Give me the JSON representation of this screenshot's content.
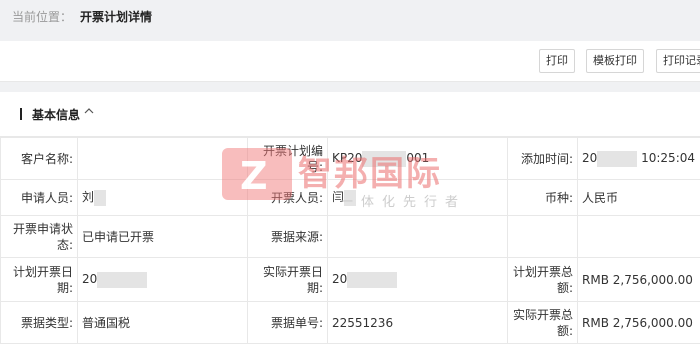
{
  "breadcrumb": {
    "label": "当前位置：",
    "current": "开票计划详情"
  },
  "toolbar": {
    "print": "打印",
    "template_print": "模板打印",
    "print_log": "打印记录"
  },
  "section": {
    "title": "基本信息"
  },
  "fields": {
    "customer_name": {
      "label": "客户名称:",
      "value": ""
    },
    "plan_no": {
      "label": "开票计划编号:",
      "value_prefix": "KP20",
      "value_suffix": "001"
    },
    "add_time": {
      "label": "添加时间:",
      "value_prefix": "20",
      "value_suffix": "10:25:04"
    },
    "applicant": {
      "label": "申请人员:",
      "value": "刘"
    },
    "issuer": {
      "label": "开票人员:",
      "value": "闫"
    },
    "currency": {
      "label": "币种:",
      "value": "人民币"
    },
    "apply_status": {
      "label": "开票申请状态:",
      "value": "已申请已开票"
    },
    "invoice_source": {
      "label": "票据来源:",
      "value": ""
    },
    "plan_date": {
      "label": "计划开票日期:",
      "value": "20"
    },
    "actual_date": {
      "label": "实际开票日期:",
      "value": "20"
    },
    "plan_total": {
      "label": "计划开票总额:",
      "value": "RMB 2,756,000.00"
    },
    "invoice_type": {
      "label": "票据类型:",
      "value": "普通国税"
    },
    "invoice_no": {
      "label": "票据单号:",
      "value": "22551236"
    },
    "actual_total": {
      "label": "实际开票总额:",
      "value": "RMB 2,756,000.00"
    }
  },
  "watermark": {
    "logo": "Z",
    "name": "智邦国际",
    "slogan": "一体化先行者"
  }
}
